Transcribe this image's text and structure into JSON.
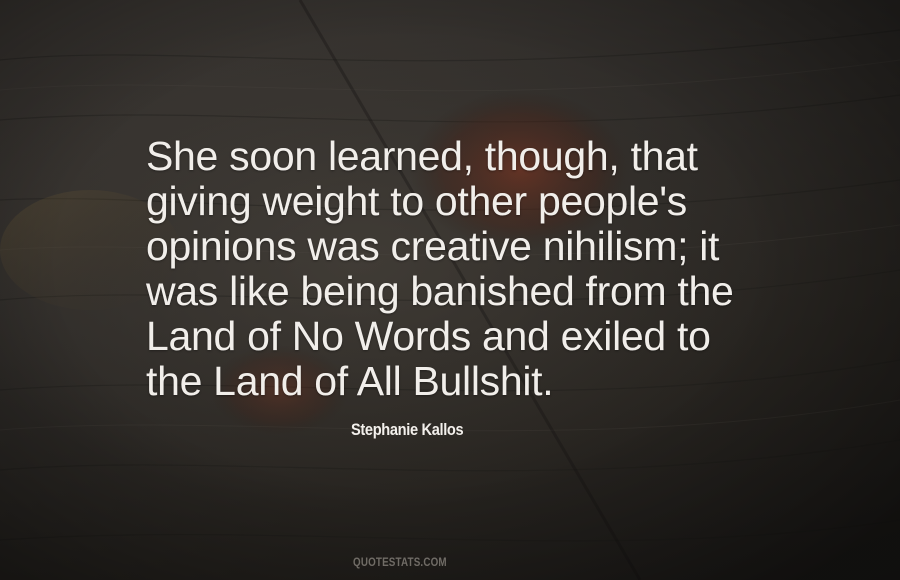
{
  "quote": {
    "lines": [
      "She soon learned, though, that",
      "giving weight to other people's",
      "opinions was creative nihilism; it",
      "was like being banished from the",
      "Land of No Words and exiled to",
      "the Land of All Bullshit."
    ]
  },
  "author": "Stephanie Kallos",
  "watermark": "QUOTESTATS.COM",
  "colors": {
    "background": "#2b2825",
    "text": "#f1eeea",
    "leaf": "#6b2a1c"
  }
}
